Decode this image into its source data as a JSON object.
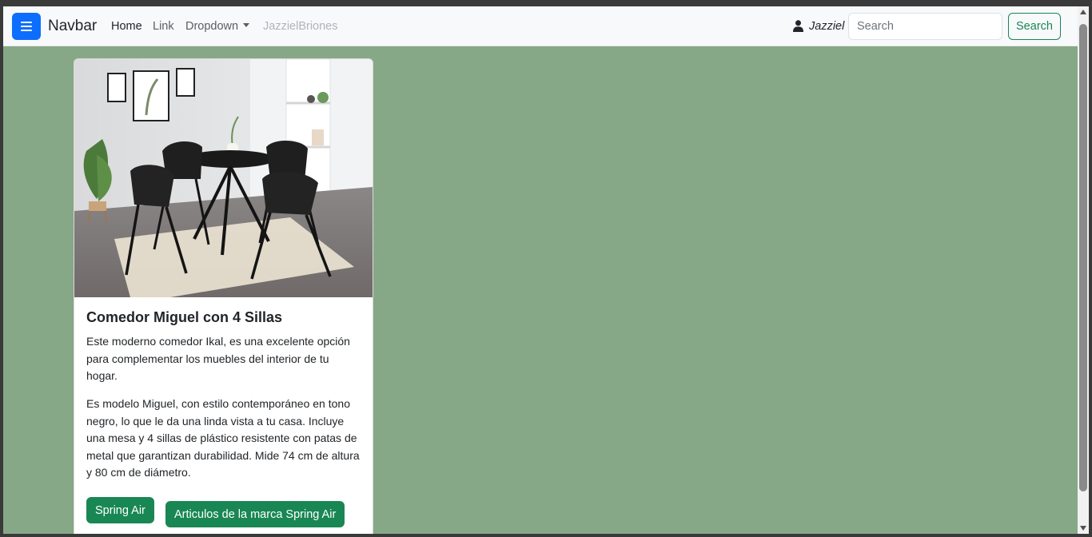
{
  "navbar": {
    "brand": "Navbar",
    "items": [
      {
        "label": "Home"
      },
      {
        "label": "Link"
      },
      {
        "label": "Dropdown"
      },
      {
        "label": "JazzielBriones"
      }
    ],
    "user_name": "Jazziel",
    "search_placeholder": "Search",
    "search_button": "Search"
  },
  "card": {
    "image_alt": "Comedor Miguel con 4 Sillas",
    "title": "Comedor Miguel con 4 Sillas",
    "paragraph1": "Este moderno comedor Ikal, es una excelente opción para complementar los muebles del interior de tu hogar.",
    "paragraph2": "Es modelo Miguel, con estilo contemporáneo en tono negro, lo que le da una linda vista a tu casa. Incluye una mesa y 4 sillas de plástico resistente con patas de metal que garantizan durabilidad. Mide 74 cm de altura y 80 cm de diámetro.",
    "button1": "Spring Air",
    "button2": "Articulos de la marca Spring Air"
  },
  "icons": {
    "toggler": "hamburger-menu-icon",
    "user": "user-icon",
    "dropdown": "caret-down-icon"
  },
  "colors": {
    "page_background": "#87a886",
    "primary": "#0d6efd",
    "success": "#198754"
  }
}
